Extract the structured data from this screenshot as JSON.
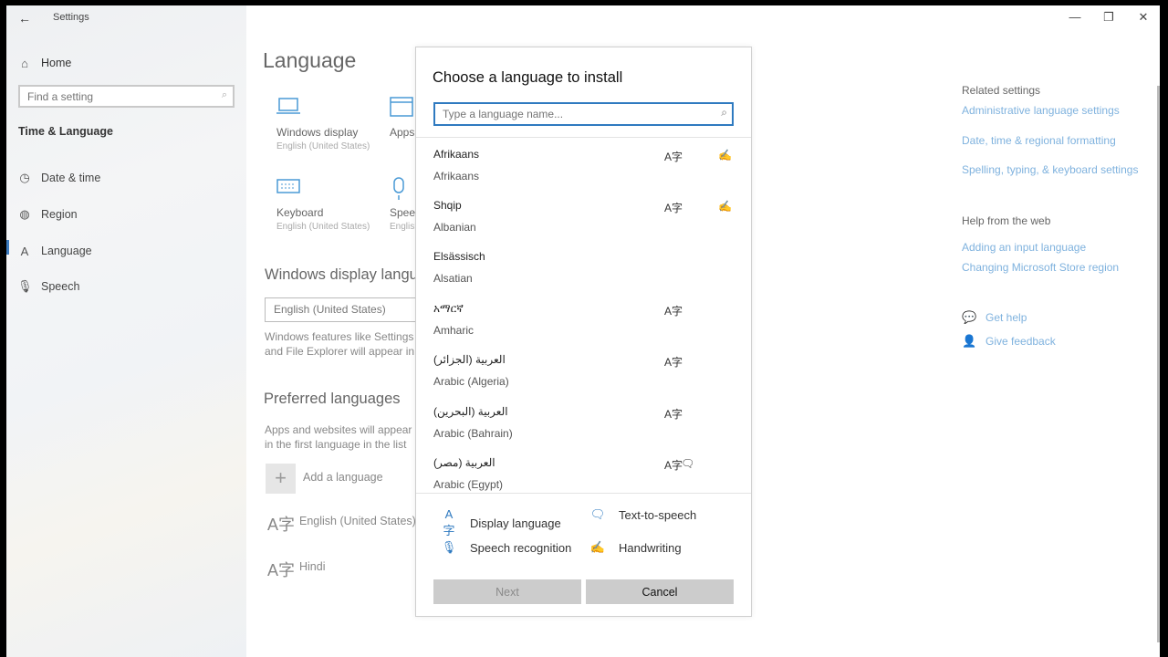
{
  "app": {
    "title": "Settings",
    "back_icon": "back-arrow-icon"
  },
  "window_controls": {
    "minimize": "—",
    "maximize": "❐",
    "close": "✕"
  },
  "sidebar": {
    "home_label": "Home",
    "search_placeholder": "Find a setting",
    "section_title": "Time & Language",
    "items": [
      {
        "label": "Date & time",
        "icon": "calendar-clock-icon"
      },
      {
        "label": "Region",
        "icon": "globe-icon"
      },
      {
        "label": "Language",
        "icon": "language-icon",
        "selected": true
      },
      {
        "label": "Speech",
        "icon": "microphone-icon"
      }
    ]
  },
  "main": {
    "page_title": "Language",
    "tiles": [
      {
        "title": "Windows display",
        "subtitle": "English (United States)"
      },
      {
        "title": "Apps",
        "subtitle": ""
      },
      {
        "title": "Keyboard",
        "subtitle": "English (United States)"
      },
      {
        "title": "Speech",
        "subtitle": "English"
      }
    ],
    "display_language_heading": "Windows display language",
    "display_language_value": "English (United States)",
    "display_language_note": "Windows features like Settings and File Explorer will appear in this language.",
    "preferred_heading": "Preferred languages",
    "preferred_note": "Apps and websites will appear in the first language in the list that they support.",
    "add_language_label": "Add a language",
    "languages": [
      "English (United States)",
      "Hindi"
    ]
  },
  "related": {
    "heading": "Related settings",
    "links": [
      "Administrative language settings",
      "Date, time & regional formatting",
      "Spelling, typing, & keyboard settings"
    ],
    "help_heading": "Help from the web",
    "help_links": [
      "Adding an input language",
      "Changing Microsoft Store region"
    ],
    "get_help": "Get help",
    "give_feedback": "Give feedback"
  },
  "dialog": {
    "title": "Choose a language to install",
    "search_placeholder": "Type a language name...",
    "languages": [
      {
        "native": "Afrikaans",
        "english": "Afrikaans",
        "features": [
          "display",
          "handwriting"
        ]
      },
      {
        "native": "Shqip",
        "english": "Albanian",
        "features": [
          "display",
          "handwriting"
        ]
      },
      {
        "native": "Elsässisch",
        "english": "Alsatian",
        "features": []
      },
      {
        "native": "አማርኛ",
        "english": "Amharic",
        "features": [
          "display"
        ]
      },
      {
        "native": "العربية (الجزائر)",
        "english": "Arabic (Algeria)",
        "features": [
          "display"
        ]
      },
      {
        "native": "العربية (البحرين)",
        "english": "Arabic (Bahrain)",
        "features": [
          "display"
        ]
      },
      {
        "native": "العربية (مصر)",
        "english": "Arabic (Egypt)",
        "features": [
          "display",
          "tts"
        ]
      }
    ],
    "legend": {
      "display": "Display language",
      "tts": "Text-to-speech",
      "speech": "Speech recognition",
      "handwriting": "Handwriting"
    },
    "next_label": "Next",
    "cancel_label": "Cancel"
  },
  "colors": {
    "accent": "#2f7ac0",
    "link": "#7fb2de",
    "button_bg": "#cccccc"
  }
}
